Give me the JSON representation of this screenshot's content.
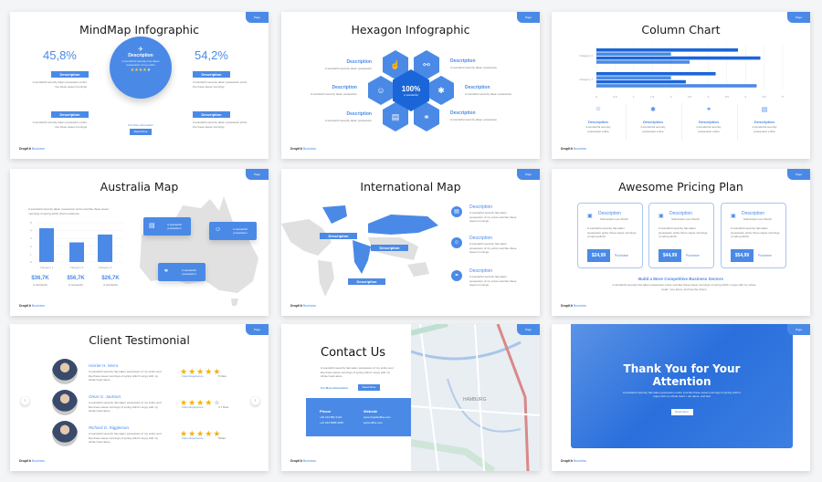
{
  "colors": {
    "accent": "#4a8ae6",
    "dark_accent": "#1a66d9",
    "star": "#f5b400"
  },
  "footer": {
    "brand": "DropKit",
    "suffix": "Business"
  },
  "page_tab": "Page",
  "slides": {
    "mindmap": {
      "title": "MindMap Infographic",
      "stat_left": "45,8%",
      "stat_right": "54,2%",
      "badge": "Description",
      "body": "A wonderful serenity taken possession entire live these sweet mornings",
      "center_title": "Description",
      "center_body": "A wonderful serenity has taken possession of my entire",
      "stars": 4,
      "more_info": "For More Information",
      "button": "Read More"
    },
    "hexagon": {
      "title": "Hexagon Infographic",
      "center_value": "100%",
      "center_sub": "A wonderful",
      "desc": "Description",
      "body": "A wonderful serenity taken possession",
      "icons": [
        "hand-pointer-icon",
        "network-icon",
        "people-icon",
        "molecule-icon",
        "store-icon",
        "handshake-icon"
      ]
    },
    "column": {
      "title": "Column Chart",
      "desc": "Description",
      "body": "A wonderful serenity possession entire",
      "icons": [
        "people-icon",
        "molecule-icon",
        "handshake-icon",
        "store-icon"
      ]
    },
    "australia": {
      "title": "Australia Map",
      "intro": "A wonderful serenity taken possession entire soul like these sweet mornings of spring which charm existence",
      "stats": [
        {
          "value": "$36,7K",
          "label": "A wonderful"
        },
        {
          "value": "$56,7K",
          "label": "A wonderful"
        },
        {
          "value": "$26,7K",
          "label": "A wonderful"
        }
      ],
      "callout": "A wonderful possession"
    },
    "international": {
      "title": "International Map",
      "map_labels": [
        "Description",
        "Description",
        "Description"
      ],
      "items": [
        {
          "title": "Description",
          "body": "A wonderful serenity has taken possession of my entire soul like these sweet mornings"
        },
        {
          "title": "Description",
          "body": "A wonderful serenity has taken possession of my entire soul like these sweet mornings"
        },
        {
          "title": "Description",
          "body": "A wonderful serenity has taken possession of my entire soul like these sweet mornings"
        }
      ]
    },
    "pricing": {
      "title": "Awesome Pricing Plan",
      "plans": [
        {
          "title": "Description",
          "sub": "Subscription per Month",
          "body": "A wonderful serenity has taken possession entire these sweet mornings of spring which",
          "price": "$24,99",
          "action": "Purchase"
        },
        {
          "title": "Description",
          "sub": "Subscription per Month",
          "body": "A wonderful serenity has taken possession entire these sweet mornings of spring which",
          "price": "$44,99",
          "action": "Purchase"
        },
        {
          "title": "Description",
          "sub": "Subscription per Month",
          "body": "A wonderful serenity has taken possession entire these sweet mornings of spring which",
          "price": "$54,99",
          "action": "Purchase"
        }
      ],
      "subheading": "Build a More Competitive Business Sectors",
      "subtext": "A wonderful serenity has taken possession entire soul like these sweet mornings of spring which I enjoy with my whole heart. I am alone, and feel the charm"
    },
    "testimonial": {
      "title": "Client Testimonial",
      "clients": [
        {
          "name": "Harriet H. Vierra",
          "body": "A wonderful serenity has taken possession of my entire soul like these sweet mornings of spring which I enjoy with my whole heart alone",
          "stars": 5,
          "label": "Client Experience",
          "rating": "5 Rate"
        },
        {
          "name": "Omar G. Jackson",
          "body": "A wonderful serenity has taken possession of my entire soul like these sweet mornings of spring which I enjoy with my whole heart alone",
          "stars": 4,
          "label": "Client Experience",
          "rating": "4.7 Rate"
        },
        {
          "name": "Richard D. Riggleman",
          "body": "A wonderful serenity has taken possession of my entire soul like these sweet mornings of spring which I enjoy with my whole heart alone",
          "stars": 5,
          "label": "Client Experience",
          "rating": "5Rate"
        }
      ]
    },
    "contact": {
      "title": "Contact Us",
      "body": "A wonderful serenity has taken possession of my entire soul like these sweet mornings of spring which I enjoy with my whole heart alone",
      "more_info": "For More Information",
      "button": "Read More",
      "phone_label": "Phone",
      "phones": [
        "+62 213 852 2124",
        "+21 324 6985 3255"
      ],
      "website_label": "Website",
      "websites": [
        "www.dropkitoffice.com",
        "www.office.com"
      ],
      "map_city": "HAMBURG"
    },
    "thanks": {
      "title_line1": "Thank You for Your",
      "title_line2": "Attention",
      "body": "A wonderful serenity has taken possession entire soul like these sweet mornings of spring which I enjoy with my whole heart. I am alone, and feel",
      "button": "Read More"
    }
  },
  "chart_data": [
    {
      "type": "bar",
      "orientation": "horizontal",
      "categories": [
        "Category 2",
        "Category 1"
      ],
      "series": [
        {
          "values": [
            3.8,
            3.2
          ]
        },
        {
          "values": [
            2.0,
            2.0
          ]
        },
        {
          "values": [
            4.4,
            2.4
          ]
        },
        {
          "values": [
            2.5,
            4.3
          ]
        }
      ],
      "xlim": [
        0,
        5
      ],
      "xticks": [
        "0",
        "0.5",
        "1",
        "1.5",
        "2",
        "2.5",
        "3",
        "3.5",
        "4",
        "4.5",
        "5"
      ],
      "grid": true
    },
    {
      "type": "bar",
      "categories": [
        "Category 1",
        "Category 2",
        "Category 3"
      ],
      "values": [
        4.3,
        2.5,
        3.5
      ],
      "ylim": [
        0,
        5
      ],
      "yticks": [
        "0",
        "1",
        "2",
        "3",
        "4",
        "5"
      ],
      "grid": true
    }
  ]
}
